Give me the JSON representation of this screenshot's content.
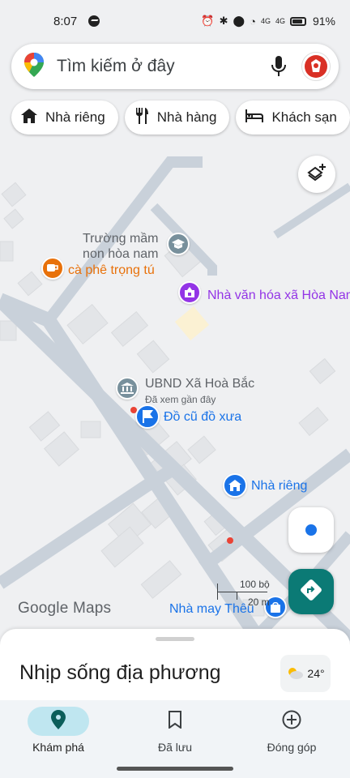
{
  "status": {
    "time": "8:07",
    "battery_pct": "91%",
    "net1": "4G",
    "net2": "4G"
  },
  "search": {
    "placeholder": "Tìm kiếm ở đây"
  },
  "chips": [
    {
      "label": "Nhà riêng",
      "icon": "home-icon"
    },
    {
      "label": "Nhà hàng",
      "icon": "restaurant-icon"
    },
    {
      "label": "Khách sạn",
      "icon": "hotel-icon"
    }
  ],
  "map": {
    "places": {
      "school": "Trường mầm\nnon hòa nam",
      "cafe": "cà phê trọng tú",
      "culture_house": "Nhà văn hóa xã Hòa Nam",
      "ubnd": "UBND Xã Hoà Bắc",
      "ubnd_note": "Đã xem gần đây",
      "antique": "Đồ cũ đồ xưa",
      "home": "Nhà riêng",
      "tailor": "Nhà may Thêu"
    },
    "scale_top": "100 bộ",
    "scale_bottom": "20 m",
    "logo": "Google Maps"
  },
  "sheet": {
    "title": "Nhịp sống địa phương",
    "weather": "24°"
  },
  "nav": [
    {
      "label": "Khám phá",
      "icon": "explore-pin-icon",
      "active": true
    },
    {
      "label": "Đã lưu",
      "icon": "bookmark-icon",
      "active": false
    },
    {
      "label": "Đóng góp",
      "icon": "add-circle-icon",
      "active": false
    }
  ],
  "colors": {
    "accent_teal": "#0b7a75",
    "blue": "#1a73e8",
    "purple": "#9334e6",
    "orange": "#e8710a",
    "active_nav": "#bfe6f0"
  }
}
